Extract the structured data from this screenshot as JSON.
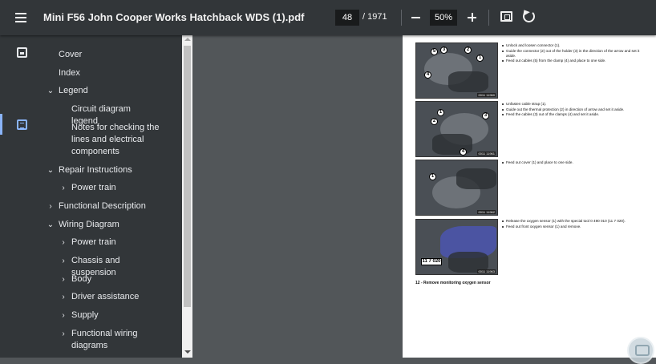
{
  "toolbar": {
    "title": "Mini F56 John Cooper Works Hatchback WDS (1).pdf",
    "page_current": "48",
    "page_total": "/ 1971",
    "zoom": "50%",
    "icons": [
      "menu-icon",
      "zoom-out-icon",
      "zoom-in-icon",
      "fit-page-icon",
      "rotate-icon"
    ]
  },
  "sidebar": {
    "rail_icons": [
      "thumbnails-icon",
      "document-outline-icon"
    ],
    "outline": [
      {
        "label": "Cover",
        "level": 0,
        "chevron": ""
      },
      {
        "label": "Index",
        "level": 0,
        "chevron": ""
      },
      {
        "label": "Legend",
        "level": 0,
        "chevron": "⌄"
      },
      {
        "label": "Circuit diagram legend",
        "level": 1,
        "chevron": ""
      },
      {
        "label": "Notes for checking the lines and electrical components",
        "level": 1,
        "chevron": ""
      },
      {
        "label": "Repair Instructions",
        "level": 0,
        "chevron": "⌄"
      },
      {
        "label": "Power train",
        "level": 1,
        "chevron": "›"
      },
      {
        "label": "Functional Description",
        "level": 0,
        "chevron": "›"
      },
      {
        "label": "Wiring Diagram",
        "level": 0,
        "chevron": "⌄"
      },
      {
        "label": "Power train",
        "level": 1,
        "chevron": "›"
      },
      {
        "label": "Chassis and suspension",
        "level": 1,
        "chevron": "›"
      },
      {
        "label": "Body",
        "level": 1,
        "chevron": "›"
      },
      {
        "label": "Driver assistance",
        "level": 1,
        "chevron": "›"
      },
      {
        "label": "Supply",
        "level": 1,
        "chevron": "›"
      },
      {
        "label": "Functional wiring diagrams",
        "level": 1,
        "chevron": "›"
      }
    ]
  },
  "document": {
    "blocks": [
      {
        "callouts": [
          "5",
          "3",
          "2",
          "1",
          "4"
        ],
        "photo_id": "0011 11960",
        "steps": [
          "Unlock and loosen connector (1).",
          "Guide the connector (2) out of the holder (3) in the direction of the arrow and set it aside.",
          "Feed out cables (5) from the clamp (4) and place to one side."
        ]
      },
      {
        "callouts": [
          "1",
          "2",
          "3",
          "4"
        ],
        "photo_id": "0011 11961",
        "steps": [
          "Unfasten cable strap (1).",
          "Guide out the thermal protection (2) in direction of arrow and set it aside.",
          "Feed the cables (3) out of the clamps (4) and set it aside."
        ]
      },
      {
        "callouts": [
          "1"
        ],
        "photo_id": "0011 11962",
        "steps": [
          "Feed out cover (1) and place to one side."
        ]
      },
      {
        "callouts": [],
        "refbox": "11 7 020",
        "photo_id": "0011 11963",
        "steps": [
          "Release the oxygen sensor (1) with the special tool 0 490 010 (11 7 020).",
          "Feed out front oxygen sensor (1) and remove."
        ],
        "link_text": "0 490 010 (11 7 020)"
      }
    ],
    "caption": "12 - Remove monitoring oxygen sensor"
  }
}
